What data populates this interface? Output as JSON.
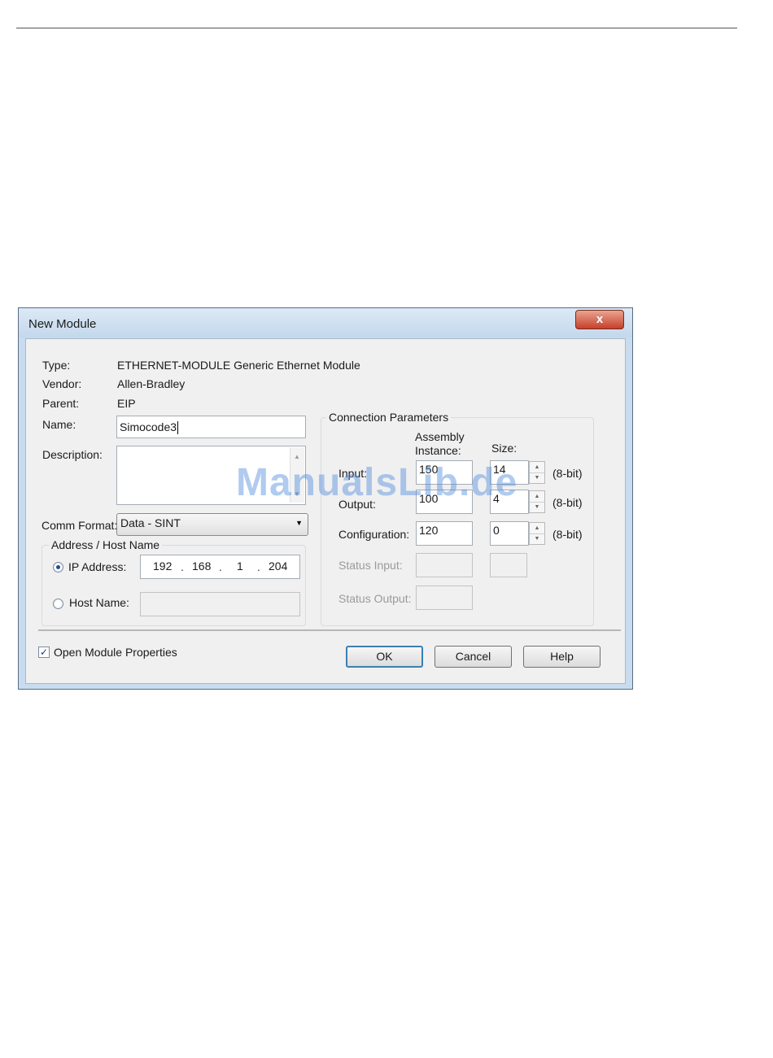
{
  "dialog": {
    "title": "New Module",
    "close_label": "x"
  },
  "info": {
    "type_label": "Type:",
    "type_value": "ETHERNET-MODULE Generic Ethernet Module",
    "vendor_label": "Vendor:",
    "vendor_value": "Allen-Bradley",
    "parent_label": "Parent:",
    "parent_value": "EIP",
    "name_label": "Name:",
    "name_value": "Simocode3",
    "description_label": "Description:",
    "description_value": ""
  },
  "comm_format": {
    "label": "Comm Format:",
    "selected": "Data - SINT"
  },
  "address": {
    "group_title": "Address / Host Name",
    "ip_label": "IP Address:",
    "ip_selected": true,
    "ip_octets": [
      "192",
      "168",
      "1",
      "204"
    ],
    "host_label": "Host Name:",
    "host_value": ""
  },
  "connection": {
    "group_title": "Connection Parameters",
    "col_assembly": "Assembly Instance:",
    "col_size": "Size:",
    "unit_label": "(8-bit)",
    "rows": [
      {
        "label": "Input:",
        "instance": "150",
        "size": "14"
      },
      {
        "label": "Output:",
        "instance": "100",
        "size": "4"
      },
      {
        "label": "Configuration:",
        "instance": "120",
        "size": "0"
      }
    ],
    "status_input_label": "Status Input:",
    "status_output_label": "Status Output:"
  },
  "footer": {
    "open_props_label": "Open Module Properties",
    "open_props_checked": true,
    "ok_label": "OK",
    "cancel_label": "Cancel",
    "help_label": "Help"
  },
  "watermark": "ManualsLib.de"
}
